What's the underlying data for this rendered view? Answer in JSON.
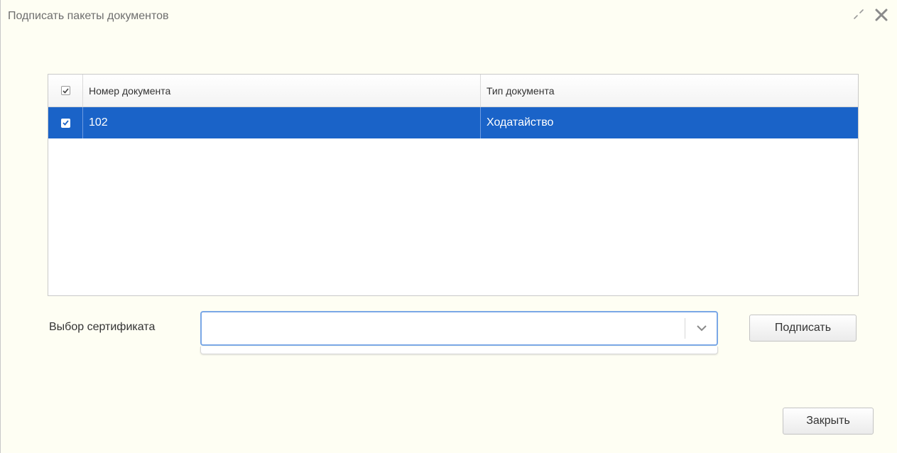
{
  "dialog": {
    "title": "Подписать пакеты документов",
    "icons": {
      "expand": "expand-icon",
      "close": "close-icon"
    }
  },
  "grid": {
    "columns": [
      {
        "key": "select",
        "label": "",
        "header_checkbox_checked": true
      },
      {
        "key": "number",
        "label": "Номер документа"
      },
      {
        "key": "type",
        "label": "Тип документа"
      }
    ],
    "rows": [
      {
        "checked": true,
        "selected": true,
        "number": "102",
        "type": "Ходатайство"
      }
    ]
  },
  "certificate": {
    "label": "Выбор сертификата",
    "value": "",
    "dropdown_open": true
  },
  "buttons": {
    "sign_label": "Подписать",
    "close_label": "Закрыть"
  },
  "colors": {
    "dialog_background": "#fefef3",
    "row_selected": "#1a63c8",
    "select_focus_border": "#7aa7e6",
    "title_text": "#6e6e6e"
  }
}
